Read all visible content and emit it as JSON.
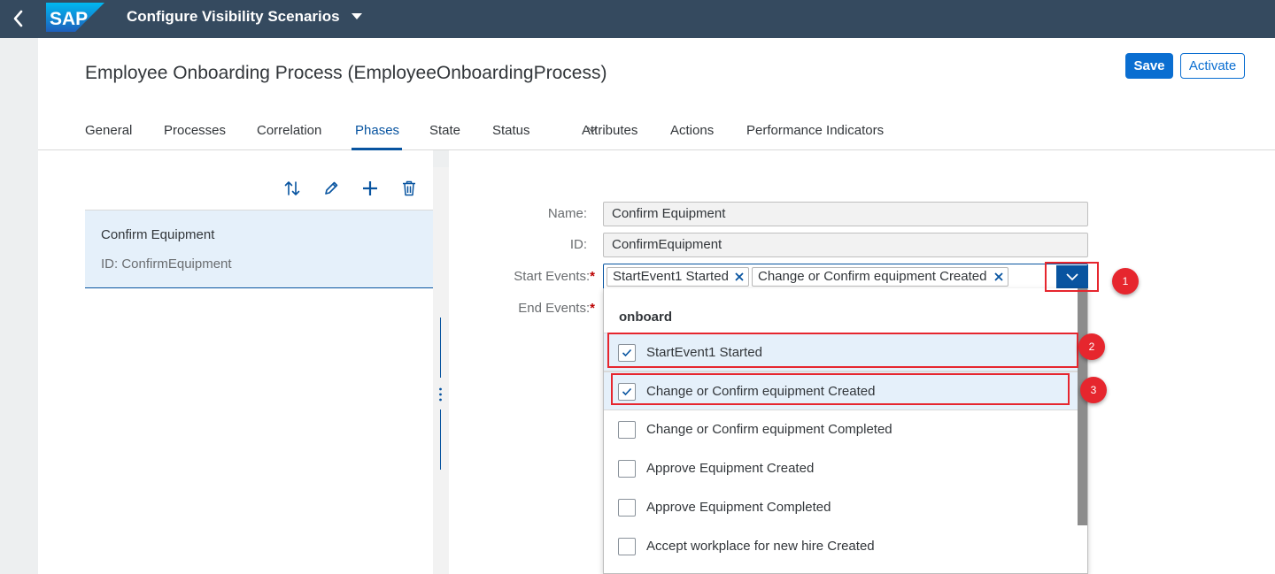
{
  "shell": {
    "title": "Configure Visibility Scenarios",
    "logo_text": "SAP",
    "icons": {
      "back": "chevron-left-icon",
      "menu": "caret-down-icon"
    },
    "background": "#354a5f"
  },
  "header": {
    "title": "Employee Onboarding Process (EmployeeOnboardingProcess)",
    "save_label": "Save",
    "activate_label": "Activate",
    "tabs": [
      {
        "label": "General"
      },
      {
        "label": "Processes"
      },
      {
        "label": "Correlation"
      },
      {
        "label": "Phases",
        "active": true
      },
      {
        "label": "State"
      },
      {
        "label": "Status",
        "has_menu": true
      },
      {
        "label": "Attributes"
      },
      {
        "label": "Actions"
      },
      {
        "label": "Performance Indicators"
      }
    ]
  },
  "phases": {
    "toolbar_icons": [
      "sort-icon",
      "edit-icon",
      "add-icon",
      "delete-icon"
    ],
    "items": [
      {
        "title": "Confirm Equipment",
        "id_text": "ID: ConfirmEquipment",
        "selected": true
      }
    ]
  },
  "form": {
    "name_label": "Name:",
    "name_value": "Confirm Equipment",
    "id_label": "ID:",
    "id_value": "ConfirmEquipment",
    "start_events_label": "Start Events:",
    "end_events_label": "End Events:",
    "required_mark": "*",
    "tokens": [
      {
        "label": "StartEvent1 Started"
      },
      {
        "label": "Change or Confirm equipment Created"
      }
    ]
  },
  "dropdown": {
    "group_header": "onboard",
    "options": [
      {
        "label": "StartEvent1 Started",
        "checked": true
      },
      {
        "label": "Change or Confirm equipment Created",
        "checked": true
      },
      {
        "label": "Change or Confirm equipment Completed",
        "checked": false
      },
      {
        "label": "Approve Equipment Created",
        "checked": false
      },
      {
        "label": "Approve Equipment Completed",
        "checked": false
      },
      {
        "label": "Accept workplace for new hire Created",
        "checked": false
      }
    ]
  },
  "annotations": {
    "badges": [
      "1",
      "2",
      "3"
    ],
    "color": "#e6262e"
  },
  "colors": {
    "brand_blue": "#0a6ed1",
    "selection": "#e5f0fa",
    "active_tab": "#0854a0"
  }
}
